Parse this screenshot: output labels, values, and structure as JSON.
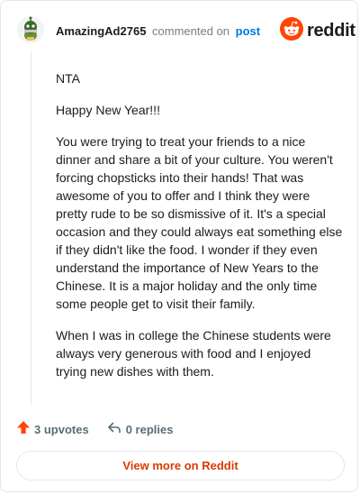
{
  "comment": {
    "author": "AmazingAd2765",
    "action": "commented on",
    "post_link": "post",
    "avatar_icon": "snoo-avatar-icon",
    "paragraphs": [
      "NTA",
      "Happy New Year!!!",
      "You were trying to treat your friends to a nice dinner and share a bit of your culture. You weren't forcing chopsticks into their hands! That was awesome of you to offer and I think they were pretty rude to be so dismissive of it. It's a special occasion and they could always eat something else if they didn't like the food. I wonder if they even understand the importance of New Years to the Chinese. It is a major holiday and the only time some people get to visit their family.",
      "When I was in college the Chinese students were always very generous with food and I enjoyed trying new dishes with them."
    ],
    "upvotes": "3 upvotes",
    "replies": "0 replies"
  },
  "brand": {
    "name": "reddit",
    "logo_icon": "reddit-logo-icon",
    "color": "#ff4500"
  },
  "footer": {
    "view_more_label": "View more on Reddit"
  },
  "colors": {
    "upvote": "#ff4500",
    "link": "#0079d3",
    "muted": "#576f76",
    "cta": "#d93a00"
  }
}
